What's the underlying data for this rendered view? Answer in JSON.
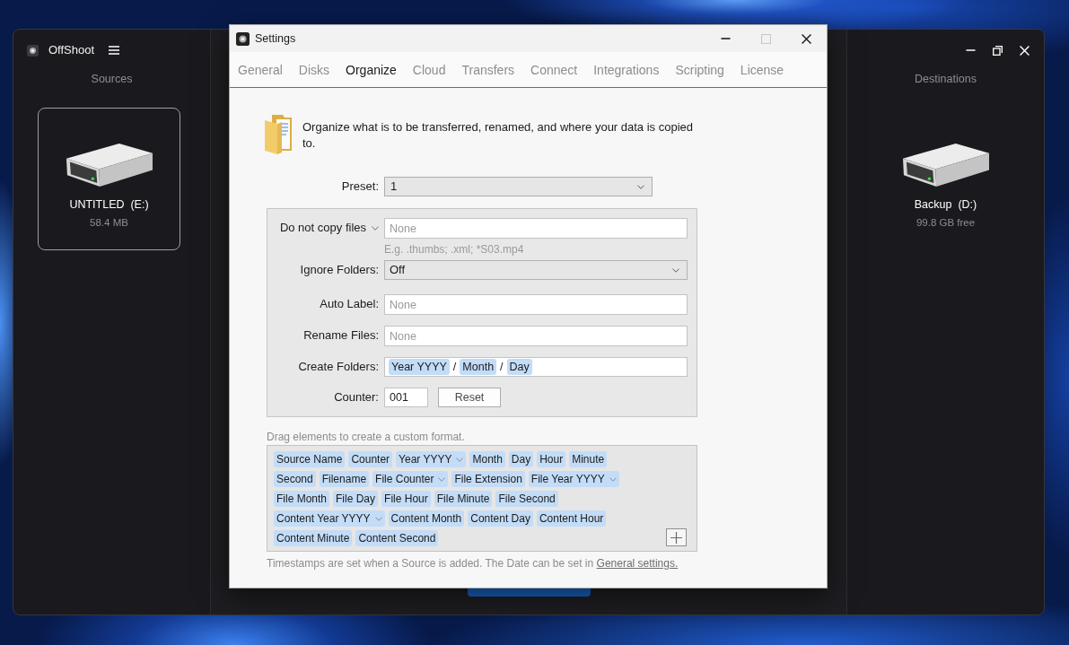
{
  "main_window": {
    "app_name": "OffShoot",
    "sources": {
      "heading": "Sources",
      "drives": [
        {
          "name": "UNTITLED  (E:)",
          "detail": "58.4 MB",
          "selected": true
        }
      ]
    },
    "destinations": {
      "heading": "Destinations",
      "drives": [
        {
          "name": "Backup  (D:)",
          "detail": "99.8 GB free",
          "selected": false
        }
      ]
    }
  },
  "settings": {
    "title": "Settings",
    "maximize_disabled": true,
    "tabs": [
      {
        "label": "General",
        "selected": false
      },
      {
        "label": "Disks",
        "selected": false
      },
      {
        "label": "Organize",
        "selected": true
      },
      {
        "label": "Cloud",
        "selected": false
      },
      {
        "label": "Transfers",
        "selected": false
      },
      {
        "label": "Connect",
        "selected": false
      },
      {
        "label": "Integrations",
        "selected": false
      },
      {
        "label": "Scripting",
        "selected": false
      },
      {
        "label": "License",
        "selected": false
      }
    ],
    "intro": "Organize what is to be transferred, renamed, and where your data is copied to.",
    "preset": {
      "label": "Preset:",
      "value": "1"
    },
    "fields": [
      {
        "kind": "text",
        "label": "Do not copy files",
        "label_dropdown": true,
        "placeholder": "None",
        "hint": "E.g. .thumbs; .xml; *S03.mp4"
      },
      {
        "kind": "select",
        "label": "Ignore Folders:",
        "label_dropdown": false,
        "value": "Off"
      },
      {
        "kind": "text",
        "label": "Auto Label:",
        "label_dropdown": false,
        "placeholder": "None"
      },
      {
        "kind": "text",
        "label": "Rename Files:",
        "label_dropdown": false,
        "placeholder": "None"
      },
      {
        "kind": "tokens",
        "label": "Create Folders:",
        "label_dropdown": false,
        "parts": [
          {
            "kind": "token",
            "text": "Year YYYY"
          },
          {
            "kind": "separator",
            "text": "/"
          },
          {
            "kind": "token",
            "text": "Month"
          },
          {
            "kind": "separator",
            "text": "/"
          },
          {
            "kind": "token",
            "text": "Day"
          }
        ]
      },
      {
        "kind": "counter",
        "label": "Counter:",
        "label_dropdown": false,
        "value": "001",
        "button": "Reset"
      }
    ],
    "palette": {
      "caption": "Drag elements to create a custom format.",
      "groups": [
        {
          "tags": [
            {
              "text": "Source Name",
              "dropdown": false
            },
            {
              "text": "Counter",
              "dropdown": false
            },
            {
              "text": "Year YYYY",
              "dropdown": true
            },
            {
              "text": "Month",
              "dropdown": false
            },
            {
              "text": "Day",
              "dropdown": false
            },
            {
              "text": "Hour",
              "dropdown": false
            },
            {
              "text": "Minute",
              "dropdown": false
            }
          ]
        },
        {
          "tags": [
            {
              "text": "Second",
              "dropdown": false
            },
            {
              "text": "Filename",
              "dropdown": false
            },
            {
              "text": "File Counter",
              "dropdown": true
            },
            {
              "text": "File Extension",
              "dropdown": false
            },
            {
              "text": "File Year YYYY",
              "dropdown": true
            }
          ]
        },
        {
          "tags": [
            {
              "text": "File Month",
              "dropdown": false
            },
            {
              "text": "File Day",
              "dropdown": false
            },
            {
              "text": "File Hour",
              "dropdown": false
            },
            {
              "text": "File Minute",
              "dropdown": false
            },
            {
              "text": "File Second",
              "dropdown": false
            }
          ]
        },
        {
          "tags": [
            {
              "text": "Content Year YYYY",
              "dropdown": true
            },
            {
              "text": "Content Month",
              "dropdown": false
            },
            {
              "text": "Content Day",
              "dropdown": false
            },
            {
              "text": "Content Hour",
              "dropdown": false
            }
          ]
        },
        {
          "tags": [
            {
              "text": "Content Minute",
              "dropdown": false
            },
            {
              "text": "Content Second",
              "dropdown": false
            }
          ]
        }
      ]
    },
    "footnote": {
      "text": "Timestamps are set when a Source is added. The Date can be set in",
      "link": "General settings."
    }
  }
}
